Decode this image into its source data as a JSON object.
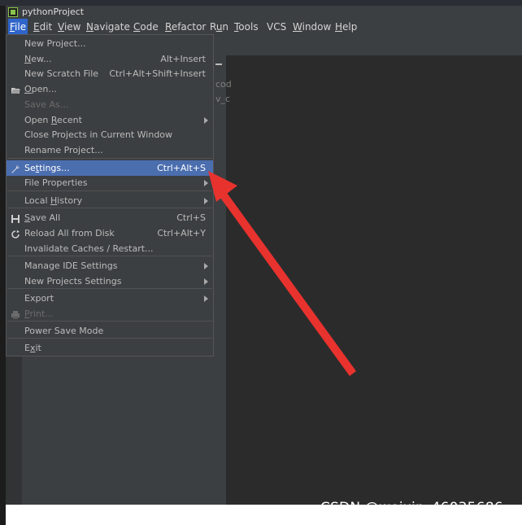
{
  "window": {
    "title": "pythonProject"
  },
  "menubar": {
    "items": [
      {
        "label": "File",
        "underline": 0,
        "active": true
      },
      {
        "label": "Edit",
        "underline": 0
      },
      {
        "label": "View",
        "underline": 0
      },
      {
        "label": "Navigate",
        "underline": 0
      },
      {
        "label": "Code",
        "underline": 0
      },
      {
        "label": "Refactor",
        "underline": 0
      },
      {
        "label": "Run",
        "underline": 1
      },
      {
        "label": "Tools",
        "underline": 0
      },
      {
        "label": "VCS",
        "underline": -1
      },
      {
        "label": "Window",
        "underline": 0
      },
      {
        "label": "Help",
        "underline": 0
      }
    ]
  },
  "background_fragments": {
    "line1": "cod",
    "line2": "v_c"
  },
  "file_menu": {
    "items": [
      {
        "label": "New Project...",
        "shortcut": "",
        "submenu": false,
        "disabled": false,
        "icon": ""
      },
      {
        "label": "New...",
        "underline_char": "N",
        "shortcut": "Alt+Insert",
        "submenu": false,
        "disabled": false,
        "icon": ""
      },
      {
        "label": "New Scratch File",
        "shortcut": "Ctrl+Alt+Shift+Insert",
        "submenu": false,
        "disabled": false,
        "icon": ""
      },
      {
        "label": "Open...",
        "underline_char": "O",
        "shortcut": "",
        "submenu": false,
        "disabled": false,
        "icon": "folder-open-icon"
      },
      {
        "label": "Save As...",
        "shortcut": "",
        "submenu": false,
        "disabled": true,
        "icon": ""
      },
      {
        "label": "Open Recent",
        "underline_char": "R",
        "shortcut": "",
        "submenu": true,
        "disabled": false,
        "icon": ""
      },
      {
        "label": "Close Projects in Current Window",
        "shortcut": "",
        "submenu": false,
        "disabled": false,
        "icon": ""
      },
      {
        "label": "Rename Project...",
        "shortcut": "",
        "submenu": false,
        "disabled": false,
        "icon": "",
        "separator_after": true
      },
      {
        "label": "Settings...",
        "underline_char": "t",
        "shortcut": "Ctrl+Alt+S",
        "submenu": false,
        "disabled": false,
        "icon": "wrench-icon",
        "selected": true
      },
      {
        "label": "File Properties",
        "shortcut": "",
        "submenu": true,
        "disabled": false,
        "icon": "",
        "separator_after": true
      },
      {
        "label": "Local History",
        "underline_char": "H",
        "shortcut": "",
        "submenu": true,
        "disabled": false,
        "icon": "",
        "separator_after": true
      },
      {
        "label": "Save All",
        "underline_char": "S",
        "shortcut": "Ctrl+S",
        "submenu": false,
        "disabled": false,
        "icon": "save-icon"
      },
      {
        "label": "Reload All from Disk",
        "shortcut": "Ctrl+Alt+Y",
        "submenu": false,
        "disabled": false,
        "icon": "reload-icon"
      },
      {
        "label": "Invalidate Caches / Restart...",
        "shortcut": "",
        "submenu": false,
        "disabled": false,
        "icon": "",
        "separator_after": true
      },
      {
        "label": "Manage IDE Settings",
        "shortcut": "",
        "submenu": true,
        "disabled": false,
        "icon": ""
      },
      {
        "label": "New Projects Settings",
        "shortcut": "",
        "submenu": true,
        "disabled": false,
        "icon": "",
        "separator_after": true
      },
      {
        "label": "Export",
        "shortcut": "",
        "submenu": true,
        "disabled": false,
        "icon": ""
      },
      {
        "label": "Print...",
        "underline_char": "P",
        "shortcut": "",
        "submenu": false,
        "disabled": true,
        "icon": "print-icon",
        "separator_after": true
      },
      {
        "label": "Power Save Mode",
        "shortcut": "",
        "submenu": false,
        "disabled": false,
        "icon": "",
        "separator_after": true
      },
      {
        "label": "Exit",
        "underline_char": "x",
        "shortcut": "",
        "submenu": false,
        "disabled": false,
        "icon": ""
      }
    ]
  },
  "annotation": {
    "arrow_color": "#e8322e"
  },
  "watermark": {
    "text": "CSDN @weixin_46035686"
  },
  "colors": {
    "menu_bg": "#3c3f41",
    "selected_bg": "#4b6eaf",
    "editor_bg": "#2b2b2b",
    "active_menu": "#2f65ca"
  }
}
